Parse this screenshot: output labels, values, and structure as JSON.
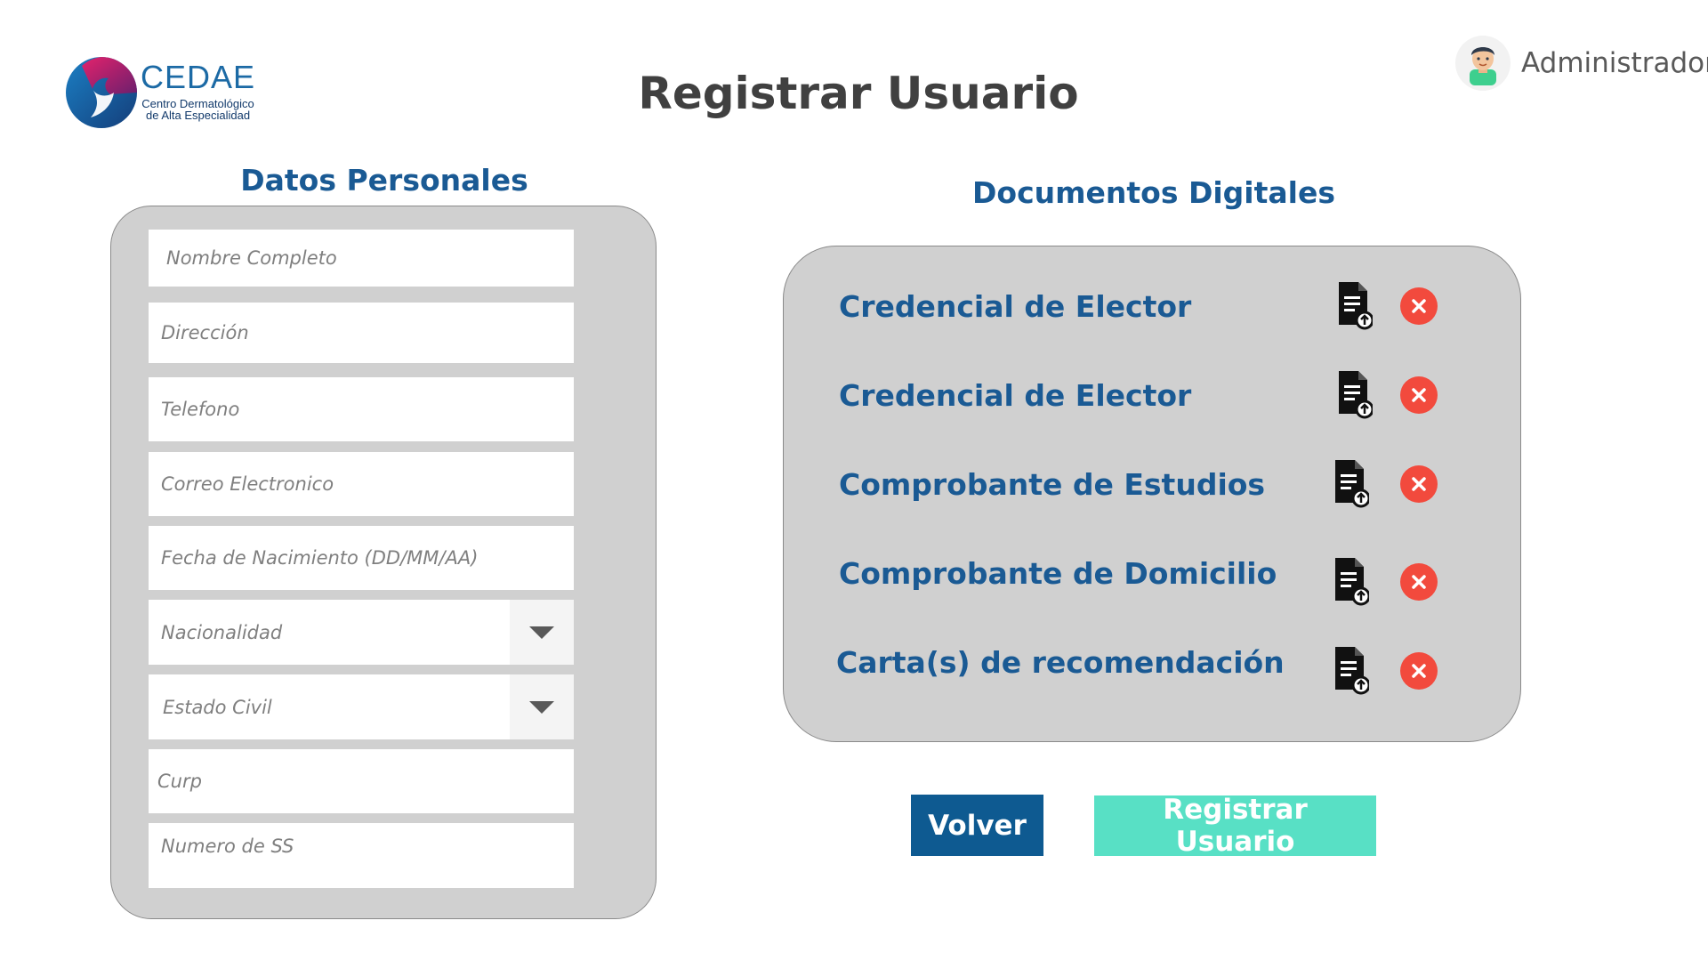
{
  "logo": {
    "name": "CEDAE",
    "subtitle_line1": "Centro Dermatológico",
    "subtitle_line2": "de Alta Especialidad"
  },
  "page": {
    "title": "Registrar Usuario"
  },
  "user": {
    "name": "Administrador",
    "avatar_icon": "user-avatar-icon"
  },
  "personal": {
    "title": "Datos Personales",
    "fields": [
      {
        "placeholder": "Nombre Completo",
        "type": "text"
      },
      {
        "placeholder": "Dirección",
        "type": "text"
      },
      {
        "placeholder": "Telefono",
        "type": "text"
      },
      {
        "placeholder": "Correo Electronico",
        "type": "text"
      },
      {
        "placeholder": "Fecha de Nacimiento (DD/MM/AA)",
        "type": "text"
      },
      {
        "placeholder": "Nacionalidad",
        "type": "select"
      },
      {
        "placeholder": "Estado Civil",
        "type": "select"
      },
      {
        "placeholder": "Curp",
        "type": "text"
      },
      {
        "placeholder": "Numero de SS",
        "type": "text"
      }
    ]
  },
  "documents": {
    "title": "Documentos Digitales",
    "items": [
      {
        "label": "Credencial de Elector"
      },
      {
        "label": "Credencial de Elector"
      },
      {
        "label": "Comprobante de Estudios"
      },
      {
        "label": "Comprobante de Domicilio"
      },
      {
        "label": "Carta(s) de recomendación"
      }
    ],
    "upload_icon": "file-upload-icon",
    "remove_icon": "remove-circle-icon"
  },
  "actions": {
    "back_label": "Volver",
    "register_label": "Registrar Usuario"
  },
  "colors": {
    "brand_blue": "#1a5a94",
    "panel_gray": "#d0d0d0",
    "back_button": "#0e5a91",
    "register_button": "#58e0c5",
    "remove_red": "#f24a3d"
  }
}
